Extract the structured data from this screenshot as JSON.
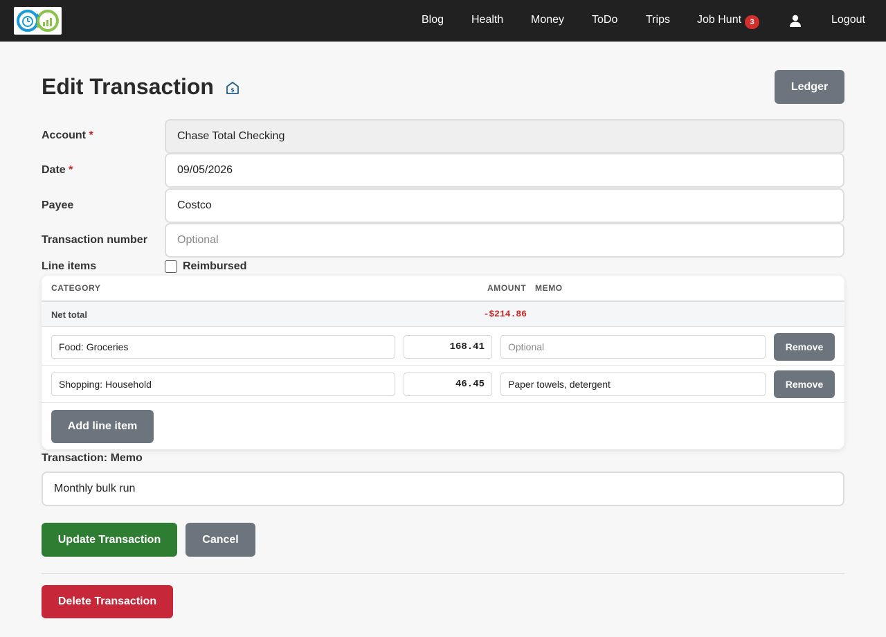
{
  "nav": {
    "links": [
      "Blog",
      "Health",
      "Money",
      "ToDo",
      "Trips",
      "Job Hunt"
    ],
    "job_hunt_badge": "3",
    "logout": "Logout"
  },
  "page": {
    "title": "Edit Transaction",
    "ledger_button": "Ledger"
  },
  "form": {
    "account": {
      "label": "Account",
      "required_mark": "*",
      "value": "Chase Total Checking"
    },
    "date": {
      "label": "Date",
      "required_mark": "*",
      "value": "09/05/2026"
    },
    "payee": {
      "label": "Payee",
      "value": "Costco"
    },
    "transaction_number": {
      "label": "Transaction number",
      "placeholder": "Optional",
      "value": ""
    },
    "line_items_label": "Line items",
    "reimbursed_label": "Reimbursed",
    "reimbursed_checked": false
  },
  "line_items": {
    "headers": {
      "category": "CATEGORY",
      "amount": "AMOUNT",
      "memo": "MEMO"
    },
    "net_total_label": "Net total",
    "net_total_value": "-$214.86",
    "rows": [
      {
        "category": "Food: Groceries",
        "amount": "168.41",
        "memo": "",
        "memo_placeholder": "Optional",
        "remove": "Remove"
      },
      {
        "category": "Shopping: Household",
        "amount": "46.45",
        "memo": "Paper towels, detergent",
        "memo_placeholder": "Optional",
        "remove": "Remove"
      }
    ],
    "add_button": "Add line item"
  },
  "memo": {
    "label": "Transaction: Memo",
    "value": "Monthly bulk run"
  },
  "actions": {
    "update": "Update Transaction",
    "cancel": "Cancel",
    "delete": "Delete Transaction"
  },
  "colors": {
    "navbar": "#212121",
    "primary_gray": "#6c757d",
    "success": "#2e7d32",
    "danger": "#c62839",
    "negative_amount": "#c62828"
  },
  "icons": [
    "logo-icon",
    "user-icon",
    "house-dollar-icon"
  ]
}
